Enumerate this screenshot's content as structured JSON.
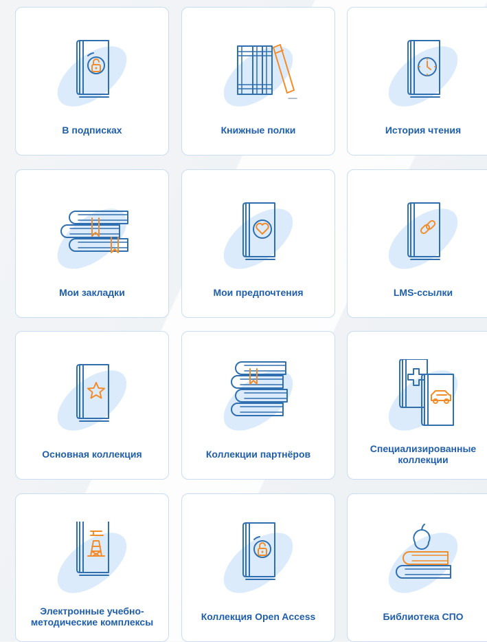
{
  "colors": {
    "accent": "#f28c28",
    "outline": "#2f6fb0",
    "label": "#1f5ea8",
    "card_border": "#c9dcf2",
    "blob": "#dcebfb"
  },
  "cards": [
    {
      "label": "В подписках",
      "icon": "book-lock-icon"
    },
    {
      "label": "Книжные полки",
      "icon": "bookshelf-icon"
    },
    {
      "label": "История чтения",
      "icon": "book-clock-icon"
    },
    {
      "label": "Мои закладки",
      "icon": "books-bookmark-icon"
    },
    {
      "label": "Мои предпочтения",
      "icon": "book-heart-icon"
    },
    {
      "label": "LMS-ссылки",
      "icon": "book-link-icon"
    },
    {
      "label": "Основная коллекция",
      "icon": "book-star-icon"
    },
    {
      "label": "Коллекции партнёров",
      "icon": "book-stack-icon"
    },
    {
      "label": "Специализированные коллекции",
      "icon": "medical-auto-books-icon"
    },
    {
      "label": "Электронные учебно-методические комплексы",
      "icon": "book-oil-rig-icon"
    },
    {
      "label": "Коллекция Open Access",
      "icon": "book-open-lock-icon"
    },
    {
      "label": "Библиотека СПО",
      "icon": "books-apple-icon"
    }
  ]
}
